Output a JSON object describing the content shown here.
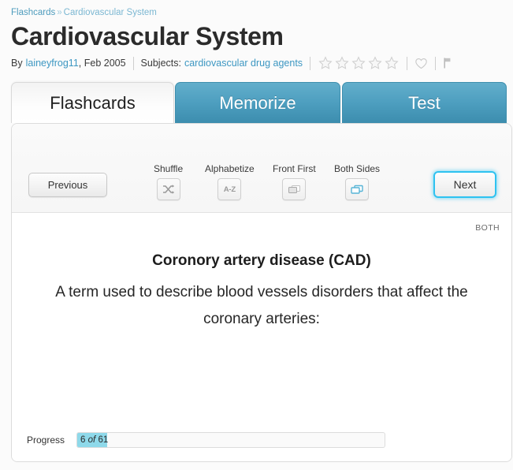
{
  "breadcrumb": {
    "root": "Flashcards",
    "separator": "»",
    "current": "Cardiovascular System"
  },
  "header": {
    "title": "Cardiovascular System",
    "by_prefix": "By",
    "author": "laineyfrog11",
    "date": ", Feb 2005",
    "subjects_label": "Subjects:",
    "subject": "cardiovascular drug agents",
    "rating_stars": 5,
    "rating_filled": 0
  },
  "tabs": [
    {
      "label": "Flashcards",
      "active": true
    },
    {
      "label": "Memorize",
      "active": false
    },
    {
      "label": "Test",
      "active": false
    }
  ],
  "toolbar": {
    "previous_label": "Previous",
    "next_label": "Next",
    "tools": [
      {
        "label": "Shuffle",
        "icon": "shuffle-icon",
        "active": false
      },
      {
        "label": "Alphabetize",
        "icon": "a-z-icon",
        "active": false,
        "glyph": "A-Z"
      },
      {
        "label": "Front First",
        "icon": "front-first-icon",
        "active": false
      },
      {
        "label": "Both Sides",
        "icon": "both-sides-icon",
        "active": true
      }
    ]
  },
  "card": {
    "side_label": "BOTH",
    "term": "Coronory artery disease (CAD)",
    "definition": "A term used to describe blood vessels disorders that affect the coronary arteries:"
  },
  "progress": {
    "label": "Progress",
    "current": "6",
    "of": "of",
    "total": "61",
    "percent": 9.8
  },
  "colors": {
    "tab_blue_top": "#62aecb",
    "tab_blue_bottom": "#3c8dae",
    "link_blue": "#3d97c2",
    "focus_cyan": "#2ec2f0",
    "progress_fill": "#8ed9ea"
  }
}
